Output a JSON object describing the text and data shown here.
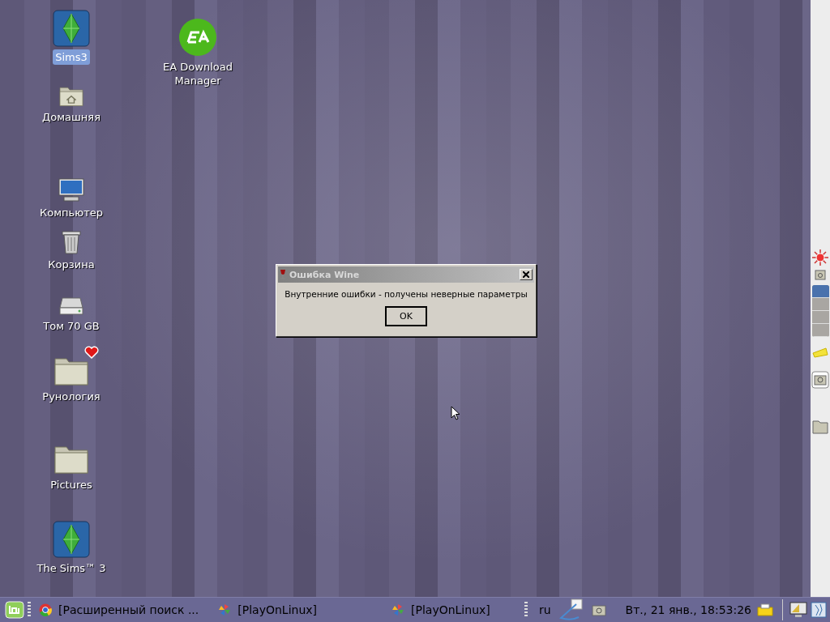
{
  "desktop_icons": [
    {
      "label": "Sims3",
      "kind": "sims",
      "selected": true
    },
    {
      "label": "EA Download Manager",
      "kind": "ea",
      "selected": false
    },
    {
      "label": "Домашняя",
      "kind": "home",
      "selected": false
    },
    {
      "label": "Компьютер",
      "kind": "computer",
      "selected": false
    },
    {
      "label": "Корзина",
      "kind": "trash",
      "selected": false
    },
    {
      "label": "Том 70 GB",
      "kind": "drive",
      "selected": false
    },
    {
      "label": "Рунология",
      "kind": "favorite-folder",
      "selected": false
    },
    {
      "label": "Pictures",
      "kind": "folder",
      "selected": false
    },
    {
      "label": "The Sims™ 3",
      "kind": "sims",
      "selected": false
    }
  ],
  "dialog": {
    "title": "Ошибка Wine",
    "message": "Внутренние ошибки - получены неверные параметры",
    "button": "OK"
  },
  "side_panel": {
    "workspaces": [
      {
        "selected": true
      },
      {
        "selected": false
      },
      {
        "selected": false
      },
      {
        "selected": false
      }
    ]
  },
  "taskbar": {
    "tasks": [
      {
        "label": "[Расширенный поиск ...",
        "kind": "browser"
      },
      {
        "label": "[PlayOnLinux]",
        "kind": "playonlinux"
      },
      {
        "label": "[PlayOnLinux]",
        "kind": "playonlinux"
      }
    ],
    "keyboard_layout": "ru",
    "clock": "Вт., 21 янв., 18:53:26"
  }
}
